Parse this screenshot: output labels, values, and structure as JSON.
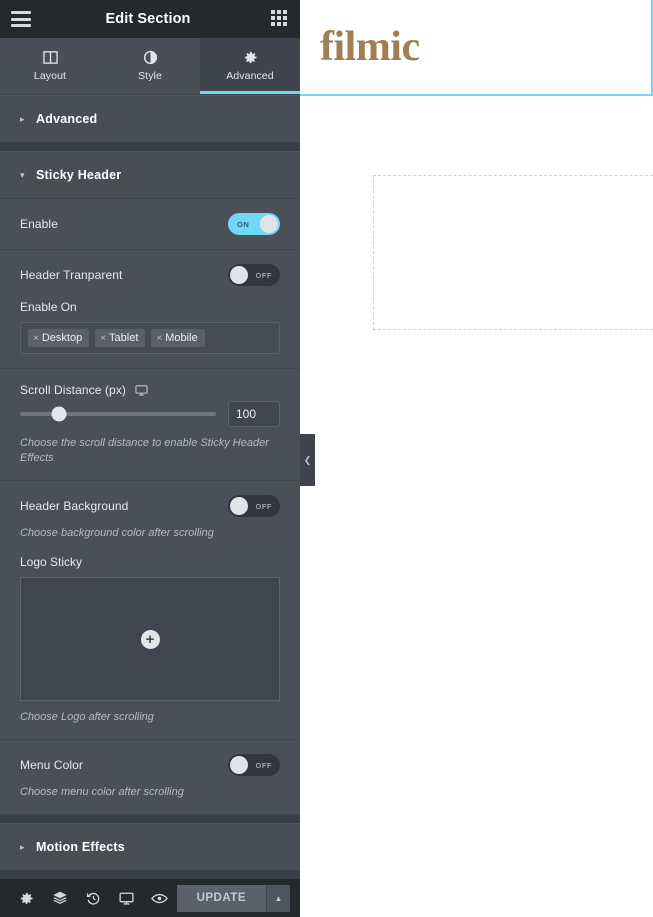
{
  "panel": {
    "header": {
      "title": "Edit Section",
      "menu_icon": "hamburger-menu-icon",
      "grid_icon": "widgets-grid-icon"
    },
    "tabs": [
      {
        "label": "Layout",
        "icon": "columns-icon",
        "active": false
      },
      {
        "label": "Style",
        "icon": "contrast-half-circle-icon",
        "active": false
      },
      {
        "label": "Advanced",
        "icon": "gear-icon",
        "active": true
      }
    ],
    "sections": {
      "advanced": {
        "title": "Advanced",
        "expanded": false,
        "caret": "▸"
      },
      "sticky_header": {
        "title": "Sticky Header",
        "expanded": true,
        "caret": "▾"
      },
      "motion_effects": {
        "title": "Motion Effects",
        "expanded": false,
        "caret": "▸"
      }
    },
    "controls": {
      "enable": {
        "label": "Enable",
        "state": "ON",
        "on": true
      },
      "header_transparent": {
        "label": "Header Tranparent",
        "state": "OFF",
        "on": false
      },
      "enable_on": {
        "label": "Enable On",
        "tags": [
          {
            "label": "Desktop",
            "remove": "×"
          },
          {
            "label": "Tablet",
            "remove": "×"
          },
          {
            "label": "Mobile",
            "remove": "×"
          }
        ]
      },
      "scroll_distance": {
        "label": "Scroll Distance (px)",
        "device_icon": "desktop-monitor-icon",
        "value": "100",
        "slider_percent": 20,
        "description": "Choose the scroll distance to enable Sticky Header Effects"
      },
      "header_background": {
        "label": "Header Background",
        "state": "OFF",
        "on": false,
        "description": "Choose background color after scrolling"
      },
      "logo_sticky": {
        "label": "Logo Sticky",
        "plus": "+",
        "upload_icon": "plus-circle-icon",
        "description": "Choose Logo after scrolling"
      },
      "menu_color": {
        "label": "Menu Color",
        "state": "OFF",
        "on": false,
        "description": "Choose menu color after scrolling"
      }
    },
    "footer": {
      "icons": [
        {
          "name": "settings-gear-icon"
        },
        {
          "name": "navigator-layers-icon"
        },
        {
          "name": "history-revisions-icon"
        },
        {
          "name": "responsive-mode-icon"
        },
        {
          "name": "preview-eye-icon"
        }
      ],
      "update_label": "UPDATE",
      "update_caret": "▲"
    },
    "collapse_handle": {
      "icon": "chevron-left-icon",
      "glyph": "❮"
    }
  },
  "preview": {
    "logo_text": "filmic",
    "logo_color": "#9d7f52",
    "selection_color": "#71d7f7",
    "placeholder_name": "empty-section-placeholder"
  }
}
